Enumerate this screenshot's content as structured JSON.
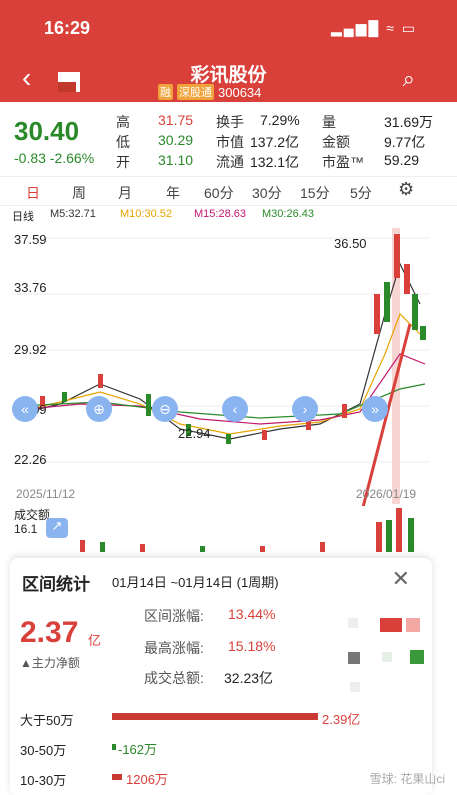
{
  "status": {
    "time": "16:29",
    "icons": "▂▄▆█ ≈ ▭"
  },
  "header": {
    "title": "彩讯股份",
    "badge_margin": "融",
    "badge_connect": "深股通",
    "code": "300634"
  },
  "quote": {
    "price": "30.40",
    "change": "-0.83 -2.66%",
    "high_label": "高",
    "high": "31.75",
    "low_label": "低",
    "low": "30.29",
    "open_label": "开",
    "open": "31.10",
    "turnover_label": "换手",
    "turnover": "7.29%",
    "mcap_label": "市值",
    "mcap": "137.2亿",
    "float_label": "流通",
    "float": "132.1亿",
    "volume_label": "量",
    "volume": "31.69万",
    "amount_label": "金额",
    "amount": "9.77亿",
    "pe_label": "市盈™",
    "pe": "59.29"
  },
  "tabs": [
    "日",
    "周",
    "月",
    "年",
    "60分",
    "30分",
    "15分",
    "5分"
  ],
  "ma": {
    "label": "日线",
    "m5": "M5:32.71",
    "m10": "M10:30.52",
    "m15": "M15:28.63",
    "m30": "M30:26.43"
  },
  "chart": {
    "y1": "37.59",
    "y2": "33.76",
    "y3": "29.92",
    "y4": "26.09",
    "y5": "22.26",
    "mark_high": "36.50",
    "mark_low": "22.94",
    "date_start": "2025/11/12",
    "date_end": "2026/01/19",
    "vol_label": "成交额",
    "vol_value": "16.1"
  },
  "panel": {
    "title": "区间统计",
    "range": "01月14日 ~01月14日 (1周期)",
    "net": "2.37",
    "net_unit": "亿",
    "net_label": "▲主力净额",
    "interval_change_label": "区间涨幅:",
    "interval_change": "13.44%",
    "max_change_label": "最高涨幅:",
    "max_change": "15.18%",
    "total_label": "成交总额:",
    "total": "32.23亿",
    "rows": [
      {
        "label": "大于50万",
        "value": "2.39亿"
      },
      {
        "label": "30-50万",
        "value": "-162万"
      },
      {
        "label": "10-30万",
        "value": "1206万"
      }
    ]
  },
  "watermark": "雪球: 花果山ci"
}
